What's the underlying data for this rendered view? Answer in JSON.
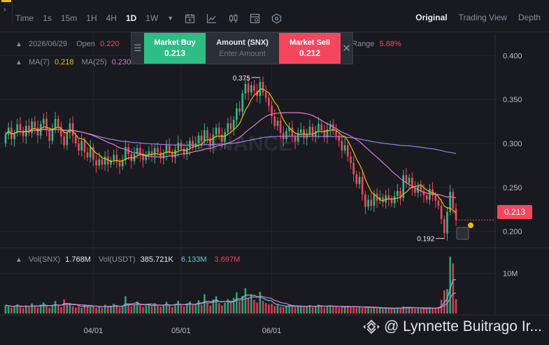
{
  "toolbar": {
    "timeframes": [
      {
        "label": "Time",
        "active": false
      },
      {
        "label": "1s",
        "active": false
      },
      {
        "label": "15m",
        "active": false
      },
      {
        "label": "1H",
        "active": false
      },
      {
        "label": "4H",
        "active": false
      },
      {
        "label": "1D",
        "active": true
      },
      {
        "label": "1W",
        "active": false
      }
    ],
    "views": [
      {
        "label": "Original",
        "active": true
      },
      {
        "label": "Trading View",
        "active": false
      },
      {
        "label": "Depth",
        "active": false
      }
    ]
  },
  "legend": {
    "date": "2026/06/29",
    "open_label": "Open",
    "open_value": "0.220",
    "range_label": "Range",
    "range_value": "5.88%",
    "ma7_label": "MA(7)",
    "ma7_value": "0.218",
    "ma25_label": "MA(25)",
    "ma25_value": "0.230"
  },
  "volume_legend": {
    "vol_snx_label": "Vol(SNX)",
    "vol_snx_value": "1.768M",
    "vol_usdt_label": "Vol(USDT)",
    "vol_usdt_value": "385.721K",
    "vol_usdt_ma1": "6.133M",
    "vol_usdt_ma2": "3.697M"
  },
  "order_panel": {
    "buy_label": "Market Buy",
    "buy_price": "0.213",
    "amount_label": "Amount (SNX)",
    "amount_placeholder": "Enter Amount",
    "sell_label": "Market Sell",
    "sell_price": "0.212"
  },
  "current_price": "0.213",
  "watermark": "@ Lynnette Buitrago Ir...",
  "colors": {
    "up": "#2ebd85",
    "down": "#f6465d",
    "ma7": "#f0b90b",
    "ma25": "#e478d0",
    "ma99": "#9b7fe6",
    "vol_ma": "#63c5da",
    "background": "#181a20"
  },
  "chart_data": {
    "type": "candlestick",
    "x_tick_labels": [
      "04/01",
      "05/01",
      "06/01"
    ],
    "y_tick_labels": [
      "0.400",
      "0.350",
      "0.300",
      "0.250",
      "0.200"
    ],
    "volume_tick_labels": [
      "10M"
    ],
    "ylim": [
      0.183,
      0.425
    ],
    "annotations": [
      {
        "text": "0.375",
        "value": 0.375,
        "type": "high"
      },
      {
        "text": "0.192",
        "value": 0.192,
        "type": "low"
      }
    ],
    "candles_close": [
      0.31,
      0.318,
      0.305,
      0.312,
      0.322,
      0.315,
      0.308,
      0.32,
      0.312,
      0.325,
      0.318,
      0.309,
      0.322,
      0.328,
      0.315,
      0.303,
      0.317,
      0.328,
      0.319,
      0.308,
      0.298,
      0.312,
      0.323,
      0.309,
      0.3,
      0.292,
      0.303,
      0.29,
      0.284,
      0.296,
      0.281,
      0.275,
      0.282,
      0.276,
      0.285,
      0.276,
      0.281,
      0.287,
      0.279,
      0.274,
      0.281,
      0.296,
      0.288,
      0.28,
      0.288,
      0.295,
      0.286,
      0.281,
      0.287,
      0.291,
      0.286,
      0.295,
      0.29,
      0.283,
      0.289,
      0.298,
      0.29,
      0.284,
      0.293,
      0.301,
      0.294,
      0.288,
      0.295,
      0.303,
      0.296,
      0.3,
      0.309,
      0.303,
      0.315,
      0.306,
      0.297,
      0.31,
      0.318,
      0.31,
      0.302,
      0.313,
      0.323,
      0.316,
      0.327,
      0.34,
      0.336,
      0.357,
      0.368,
      0.358,
      0.366,
      0.36,
      0.354,
      0.37,
      0.358,
      0.352,
      0.343,
      0.331,
      0.32,
      0.326,
      0.312,
      0.305,
      0.314,
      0.318,
      0.308,
      0.302,
      0.312,
      0.316,
      0.306,
      0.311,
      0.319,
      0.308,
      0.314,
      0.322,
      0.315,
      0.307,
      0.316,
      0.322,
      0.314,
      0.309,
      0.303,
      0.292,
      0.298,
      0.285,
      0.278,
      0.265,
      0.254,
      0.262,
      0.242,
      0.228,
      0.236,
      0.229,
      0.243,
      0.235,
      0.239,
      0.233,
      0.241,
      0.237,
      0.232,
      0.24,
      0.246,
      0.238,
      0.264,
      0.255,
      0.261,
      0.249,
      0.244,
      0.252,
      0.246,
      0.241,
      0.236,
      0.248,
      0.241,
      0.235,
      0.229,
      0.214,
      0.198,
      0.222,
      0.245,
      0.226,
      0.213
    ],
    "candles_open": [
      0.3,
      0.31,
      0.318,
      0.305,
      0.312,
      0.322,
      0.315,
      0.308,
      0.32,
      0.312,
      0.325,
      0.318,
      0.309,
      0.322,
      0.328,
      0.315,
      0.303,
      0.317,
      0.328,
      0.319,
      0.308,
      0.298,
      0.312,
      0.323,
      0.309,
      0.3,
      0.292,
      0.303,
      0.29,
      0.284,
      0.296,
      0.281,
      0.275,
      0.282,
      0.276,
      0.285,
      0.276,
      0.281,
      0.287,
      0.279,
      0.274,
      0.281,
      0.296,
      0.288,
      0.28,
      0.288,
      0.295,
      0.286,
      0.281,
      0.287,
      0.291,
      0.286,
      0.295,
      0.29,
      0.283,
      0.289,
      0.298,
      0.29,
      0.284,
      0.293,
      0.301,
      0.294,
      0.288,
      0.295,
      0.303,
      0.296,
      0.3,
      0.309,
      0.303,
      0.315,
      0.306,
      0.297,
      0.31,
      0.318,
      0.31,
      0.302,
      0.313,
      0.323,
      0.316,
      0.327,
      0.34,
      0.336,
      0.357,
      0.368,
      0.358,
      0.366,
      0.36,
      0.354,
      0.37,
      0.358,
      0.352,
      0.343,
      0.331,
      0.32,
      0.326,
      0.312,
      0.305,
      0.314,
      0.318,
      0.308,
      0.302,
      0.312,
      0.316,
      0.306,
      0.311,
      0.319,
      0.308,
      0.314,
      0.322,
      0.315,
      0.307,
      0.316,
      0.322,
      0.314,
      0.309,
      0.303,
      0.292,
      0.298,
      0.285,
      0.278,
      0.265,
      0.254,
      0.262,
      0.242,
      0.228,
      0.236,
      0.229,
      0.243,
      0.235,
      0.239,
      0.233,
      0.241,
      0.237,
      0.232,
      0.24,
      0.246,
      0.238,
      0.264,
      0.255,
      0.261,
      0.249,
      0.244,
      0.252,
      0.246,
      0.241,
      0.236,
      0.248,
      0.241,
      0.235,
      0.229,
      0.214,
      0.198,
      0.222,
      0.245,
      0.226
    ],
    "volume_millions": [
      2.1,
      1.8,
      1.5,
      1.9,
      2.3,
      1.7,
      1.4,
      2.0,
      1.6,
      2.5,
      1.9,
      1.5,
      2.2,
      2.8,
      1.8,
      1.4,
      2.0,
      3.1,
      2.2,
      1.6,
      3.5,
      2.1,
      2.6,
      1.8,
      1.5,
      1.7,
      1.4,
      2.3,
      1.9,
      1.6,
      2.0,
      1.5,
      1.8,
      1.4,
      2.2,
      1.6,
      1.9,
      2.4,
      1.7,
      1.5,
      1.9,
      4.3,
      2.5,
      1.8,
      2.1,
      3.0,
      2.2,
      1.6,
      1.9,
      2.3,
      1.8,
      2.6,
      2.0,
      1.7,
      2.2,
      2.9,
      2.0,
      1.6,
      2.4,
      3.2,
      2.1,
      1.8,
      2.3,
      3.0,
      2.1,
      2.4,
      3.3,
      2.2,
      4.8,
      2.6,
      2.0,
      3.5,
      4.3,
      2.6,
      2.0,
      2.7,
      3.6,
      2.6,
      3.9,
      5.3,
      3.1,
      4.4,
      6.3,
      3.9,
      4.8,
      3.4,
      2.7,
      5.4,
      3.1,
      2.6,
      2.3,
      2.4,
      1.9,
      2.1,
      1.7,
      1.6,
      1.9,
      2.1,
      1.7,
      1.5,
      1.9,
      2.0,
      1.6,
      1.8,
      2.1,
      1.6,
      1.9,
      2.2,
      1.8,
      1.5,
      1.9,
      2.1,
      1.7,
      1.6,
      1.5,
      1.8,
      1.6,
      1.9,
      1.7,
      1.8,
      1.5,
      1.6,
      1.4,
      1.7,
      1.5,
      1.3,
      1.5,
      1.4,
      1.3,
      1.2,
      1.4,
      1.3,
      1.2,
      1.4,
      1.5,
      1.3,
      1.8,
      1.5,
      1.6,
      1.3,
      1.2,
      1.4,
      1.3,
      1.2,
      1.3,
      1.5,
      1.3,
      1.4,
      1.6,
      3.4,
      5.8,
      6.1,
      14.2,
      12.5,
      3.6
    ]
  }
}
